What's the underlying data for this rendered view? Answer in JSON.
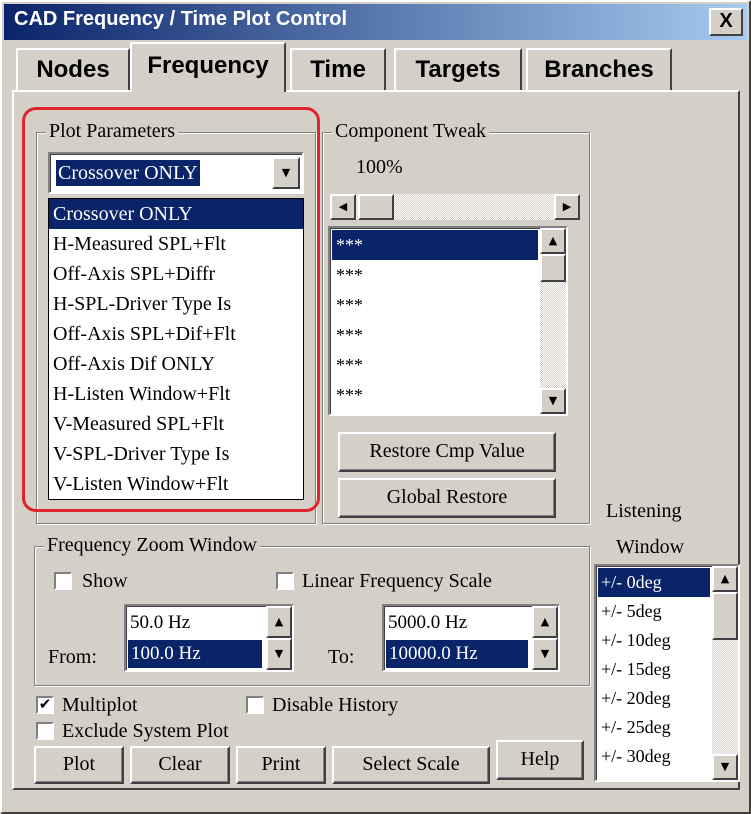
{
  "window": {
    "title": "CAD Frequency / Time Plot Control",
    "close": "X"
  },
  "tabs": [
    {
      "label": "Nodes"
    },
    {
      "label": "Frequency",
      "active": true
    },
    {
      "label": "Time"
    },
    {
      "label": "Targets"
    },
    {
      "label": "Branches"
    }
  ],
  "plot_parameters": {
    "label": "Plot Parameters",
    "selected": "Crossover ONLY",
    "options": [
      "Crossover ONLY",
      "H-Measured SPL+Flt",
      "Off-Axis SPL+Diffr",
      "H-SPL-Driver Type Is",
      "Off-Axis SPL+Dif+Flt",
      "Off-Axis Dif ONLY",
      "H-Listen Window+Flt",
      "V-Measured SPL+Flt",
      "V-SPL-Driver Type Is",
      "V-Listen Window+Flt"
    ]
  },
  "component_tweak": {
    "label": "Component Tweak",
    "value": "100%",
    "items": [
      "***",
      "***",
      "***",
      "***",
      "***",
      "***"
    ],
    "restore_button": "Restore Cmp Value",
    "global_restore_button": "Global Restore"
  },
  "frequency_zoom": {
    "label": "Frequency Zoom Window",
    "show_label": "Show",
    "show_checked": false,
    "linear_label": "Linear Frequency Scale",
    "linear_checked": false,
    "from_label": "From:",
    "from_values": [
      "50.0 Hz",
      "100.0 Hz"
    ],
    "to_label": "To:",
    "to_values": [
      "5000.0 Hz",
      "10000.0 Hz"
    ]
  },
  "options": {
    "multiplot_label": "Multiplot",
    "multiplot_checked": true,
    "disable_history_label": "Disable History",
    "disable_history_checked": false,
    "exclude_system_label": "Exclude System Plot",
    "exclude_system_checked": false
  },
  "buttons": {
    "plot": "Plot",
    "clear": "Clear",
    "print": "Print",
    "select_scale": "Select Scale",
    "help": "Help"
  },
  "listening_window": {
    "label_line1": "Listening",
    "label_line2": "Window",
    "items": [
      "+/- 0deg",
      "+/- 5deg",
      "+/- 10deg",
      "+/- 15deg",
      "+/- 20deg",
      "+/- 25deg",
      "+/- 30deg"
    ],
    "selected_index": 0
  },
  "colors": {
    "title_bar": "#0a246a",
    "selection": "#0a246a",
    "highlight_outline": "#e0242e",
    "face": "#d4d0c8"
  }
}
